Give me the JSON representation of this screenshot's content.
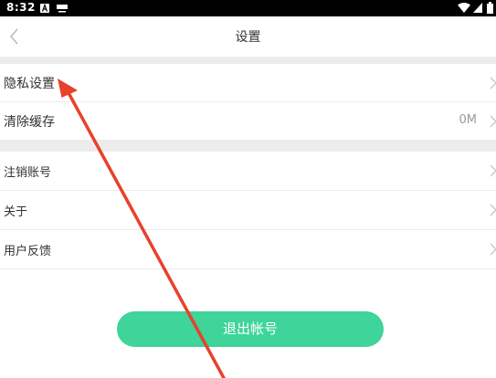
{
  "status_bar": {
    "time": "8:32"
  },
  "header": {
    "title": "设置"
  },
  "section1": {
    "items": [
      {
        "label": "隐私设置"
      },
      {
        "label": "清除缓存",
        "value": "0M"
      }
    ]
  },
  "section2": {
    "items": [
      {
        "label": "注销账号"
      },
      {
        "label": "关于"
      },
      {
        "label": "用户反馈"
      }
    ]
  },
  "logout": {
    "label": "退出帐号"
  },
  "colors": {
    "accent": "#3ed49a",
    "annotation_arrow": "#e8412c"
  }
}
